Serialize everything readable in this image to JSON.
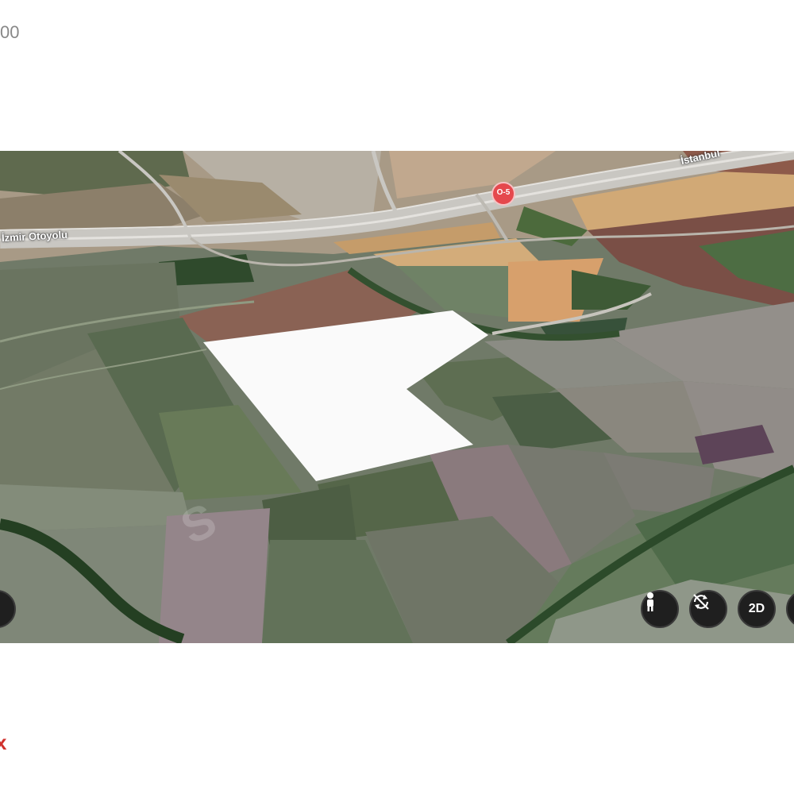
{
  "page": {
    "corner_top_text": "00",
    "corner_bottom_text": "x"
  },
  "map": {
    "road_labels": {
      "left": "İzmir Otoyolu",
      "right": "İstanbul"
    },
    "highway_marker": "O-5",
    "watermark": "S",
    "controls": {
      "street_view_icon": "person-icon",
      "rotate_icon": "rotate-icon",
      "view_mode_label": "2D"
    }
  }
}
